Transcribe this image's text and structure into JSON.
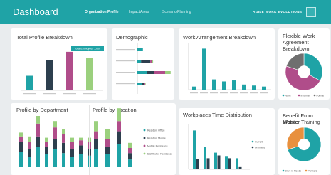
{
  "header": {
    "title": "Dashboard",
    "nav": [
      "Organization Profile",
      "Impact Areas",
      "Scenario Planning"
    ],
    "brand": "AGILE WORK EVOLUTIONS",
    "colors": {
      "bar": "#1fa3a6",
      "background": "#e9ecee"
    }
  },
  "panels": {
    "total_profile": "Total Profile Breakdown",
    "demographic": "Demographic",
    "work_arrangement": "Work Arrangement Breakdown",
    "flexible_work": [
      "Flexible Work",
      "Agreement",
      "Breakdown"
    ],
    "profile_dept": "Profile by Department",
    "profile_location": "Profile by Location",
    "time_distribution": "Workplaces Time Distribution",
    "mobile_benefit": [
      "Benefit From Mobile",
      "Worker Training"
    ]
  },
  "series_colors": [
    "#1fa3a6",
    "#2d3f4e",
    "#b04d8a",
    "#9bd07e"
  ],
  "legend": [
    "Resident Office",
    "Resident Mobile",
    "Mobile Residence",
    "Distributed Residence"
  ],
  "total_profile_values": [
    25,
    52,
    66,
    55
  ],
  "total_profile_badge": "Total Employees   1,000",
  "work_arrangement_values": [
    6,
    80,
    20,
    16,
    18,
    10,
    8,
    6
  ],
  "time_legend": [
    "Current",
    "Unlimited"
  ],
  "flexible_legend": [
    "None",
    "Informal",
    "Formal"
  ],
  "mobile_legend": [
    "Drive-in Needs",
    "Partners"
  ]
}
